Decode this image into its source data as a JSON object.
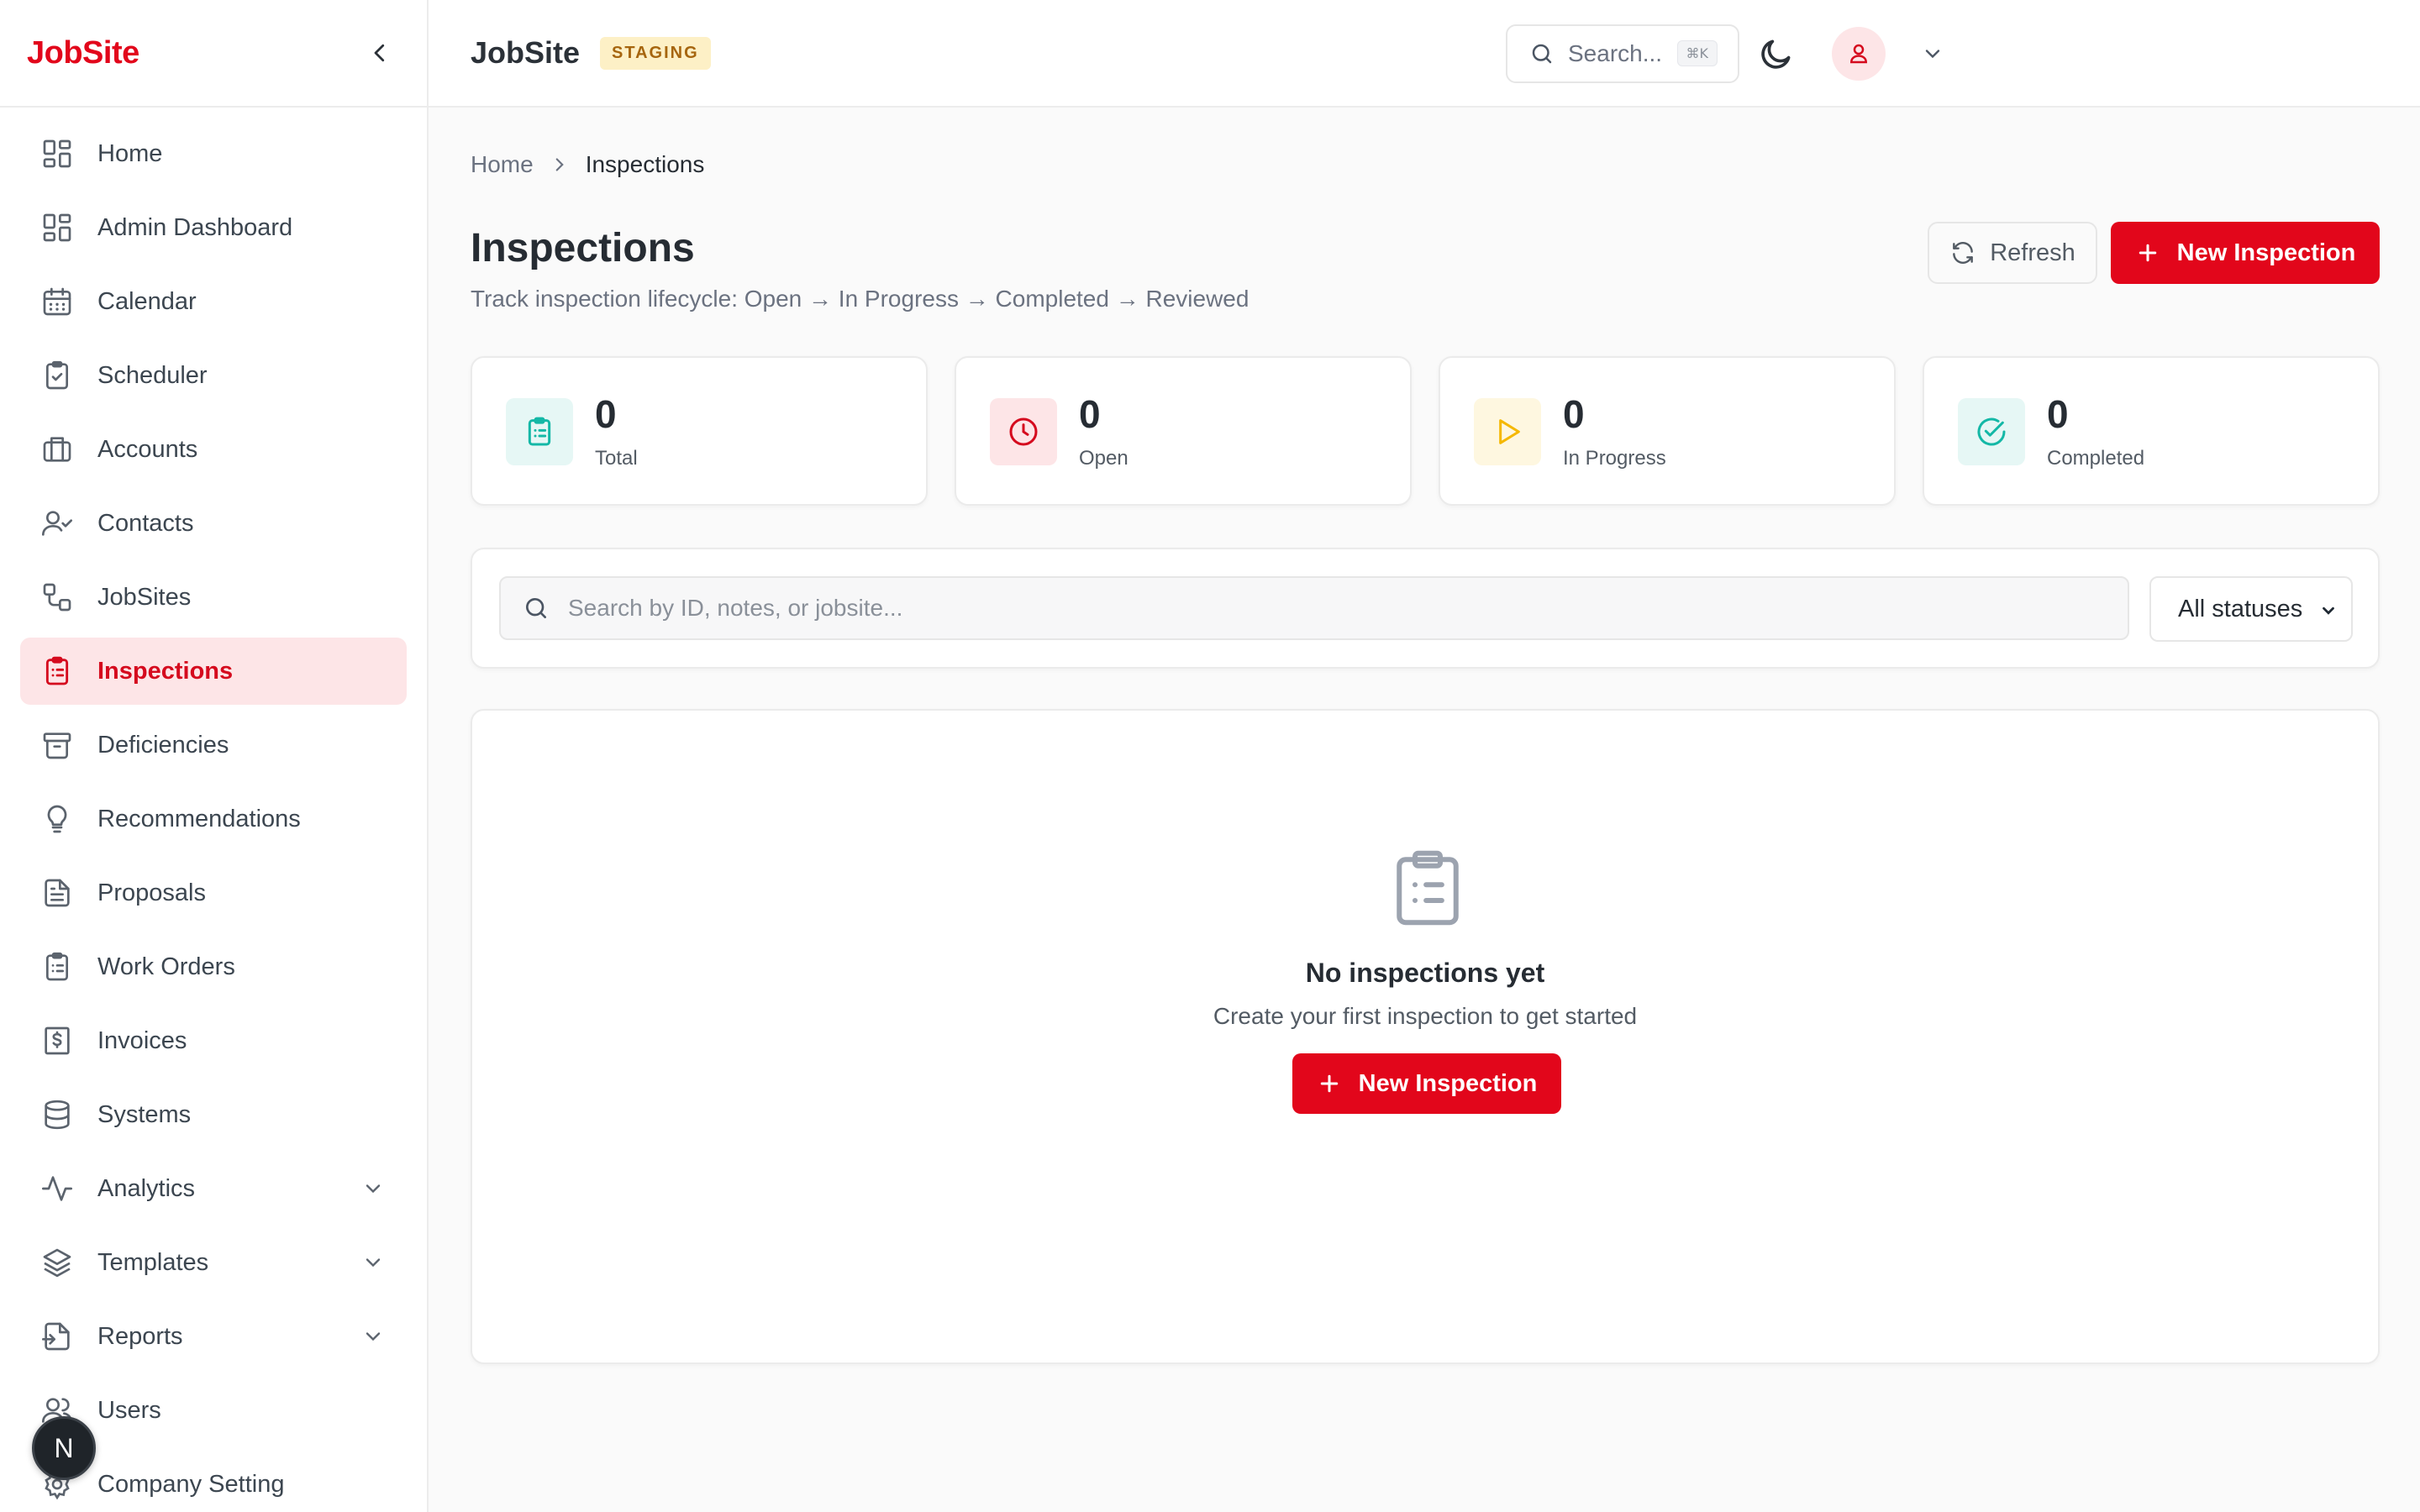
{
  "sidebar": {
    "brand": "JobSite",
    "items": [
      {
        "label": "Home",
        "icon": "grid-icon"
      },
      {
        "label": "Admin Dashboard",
        "icon": "grid-icon"
      },
      {
        "label": "Calendar",
        "icon": "calendar-icon"
      },
      {
        "label": "Scheduler",
        "icon": "clipboard-check-icon"
      },
      {
        "label": "Accounts",
        "icon": "briefcase-icon"
      },
      {
        "label": "Contacts",
        "icon": "user-check-icon"
      },
      {
        "label": "JobSites",
        "icon": "route-icon"
      },
      {
        "label": "Inspections",
        "icon": "clipboard-list-icon",
        "active": true
      },
      {
        "label": "Deficiencies",
        "icon": "archive-icon"
      },
      {
        "label": "Recommendations",
        "icon": "lightbulb-icon"
      },
      {
        "label": "Proposals",
        "icon": "file-text-icon"
      },
      {
        "label": "Work Orders",
        "icon": "clipboard-list-icon"
      },
      {
        "label": "Invoices",
        "icon": "receipt-dollar-icon"
      },
      {
        "label": "Systems",
        "icon": "database-icon"
      },
      {
        "label": "Analytics",
        "icon": "activity-icon",
        "expandable": true
      },
      {
        "label": "Templates",
        "icon": "layers-icon",
        "expandable": true
      },
      {
        "label": "Reports",
        "icon": "file-export-icon",
        "expandable": true
      },
      {
        "label": "Users",
        "icon": "users-icon"
      },
      {
        "label": "Company Setting",
        "icon": "gear-icon"
      }
    ],
    "floating_badge": "N"
  },
  "topbar": {
    "title": "JobSite",
    "env_badge": "STAGING",
    "search_placeholder": "Search...",
    "search_shortcut": "⌘K"
  },
  "breadcrumb": {
    "home": "Home",
    "current": "Inspections"
  },
  "page": {
    "title": "Inspections",
    "subtitle": "Track inspection lifecycle: Open → In Progress → Completed → Reviewed",
    "refresh_label": "Refresh",
    "new_label": "New Inspection"
  },
  "stats": [
    {
      "value": "0",
      "label": "Total",
      "icon": "clipboard-list-icon",
      "color": "#14b8a6",
      "bg": "#e6f7f5"
    },
    {
      "value": "0",
      "label": "Open",
      "icon": "clock-icon",
      "color": "#d50a1e",
      "bg": "#fde5e7"
    },
    {
      "value": "0",
      "label": "In Progress",
      "icon": "play-icon",
      "color": "#f5b800",
      "bg": "#fef7e0"
    },
    {
      "value": "0",
      "label": "Completed",
      "icon": "check-circle-icon",
      "color": "#14b8a6",
      "bg": "#e6f7f5"
    }
  ],
  "filters": {
    "search_placeholder": "Search by ID, notes, or jobsite...",
    "search_value": "",
    "status_selected": "All statuses"
  },
  "empty_state": {
    "title": "No inspections yet",
    "subtitle": "Create your first inspection to get started",
    "button_label": "New Inspection"
  },
  "colors": {
    "brand": "#e2061b",
    "active_bg": "#fde5e7",
    "active_text": "#d50a1e"
  }
}
